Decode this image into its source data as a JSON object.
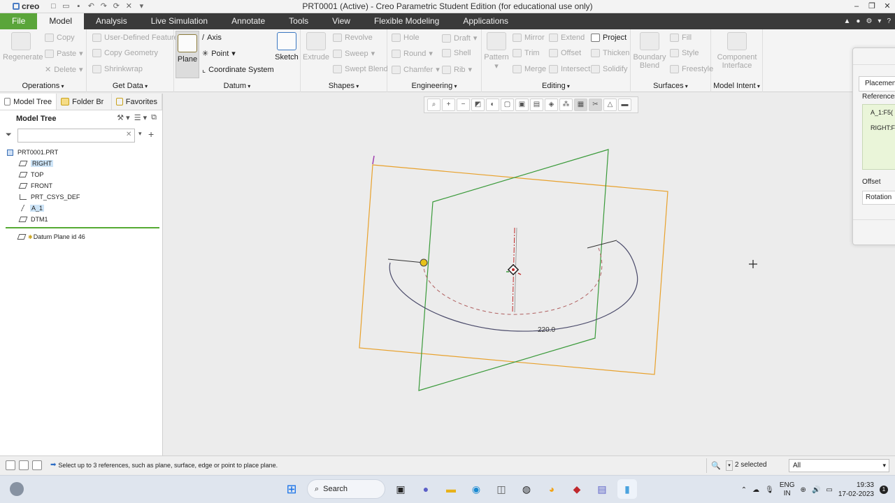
{
  "titlebar": {
    "logo": "creo",
    "title": "PRT0001 (Active) - Creo Parametric Student Edition (for educational use only)"
  },
  "tabs": [
    "File",
    "Model",
    "Analysis",
    "Live Simulation",
    "Annotate",
    "Tools",
    "View",
    "Flexible Modeling",
    "Applications"
  ],
  "active_tab": "Model",
  "ribbon": {
    "operations": {
      "label": "Operations",
      "regenerate": "Regenerate",
      "copy": "Copy",
      "paste": "Paste",
      "delete": "Delete"
    },
    "get_data": {
      "label": "Get Data",
      "udf": "User-Defined Feature",
      "copy_geometry": "Copy Geometry",
      "shrinkwrap": "Shrinkwrap"
    },
    "datum": {
      "label": "Datum",
      "plane": "Plane",
      "axis": "Axis",
      "point": "Point",
      "csys": "Coordinate System",
      "sketch": "Sketch"
    },
    "shapes": {
      "label": "Shapes",
      "extrude": "Extrude",
      "revolve": "Revolve",
      "sweep": "Sweep",
      "swept_blend": "Swept Blend"
    },
    "engineering": {
      "label": "Engineering",
      "hole": "Hole",
      "draft": "Draft",
      "round": "Round",
      "shell": "Shell",
      "chamfer": "Chamfer",
      "rib": "Rib"
    },
    "editing": {
      "label": "Editing",
      "pattern": "Pattern",
      "mirror": "Mirror",
      "extend": "Extend",
      "project": "Project",
      "trim": "Trim",
      "offset": "Offset",
      "thicken": "Thicken",
      "merge": "Merge",
      "intersect": "Intersect",
      "solidify": "Solidify"
    },
    "surfaces": {
      "label": "Surfaces",
      "boundary_blend": "Boundary Blend",
      "fill": "Fill",
      "style": "Style",
      "freestyle": "Freestyle"
    },
    "model_intent": {
      "label": "Model Intent",
      "component_interface": "Component Interface"
    }
  },
  "left_panel": {
    "tabs": [
      "Model Tree",
      "Folder Br",
      "Favorites"
    ],
    "header": "Model Tree",
    "search_value": "",
    "tree": [
      {
        "label": "PRT0001.PRT",
        "icon": "part-icon",
        "highlight": false
      },
      {
        "label": "RIGHT",
        "icon": "datum-plane-icon",
        "highlight": true
      },
      {
        "label": "TOP",
        "icon": "datum-plane-icon",
        "highlight": false
      },
      {
        "label": "FRONT",
        "icon": "datum-plane-icon",
        "highlight": false
      },
      {
        "label": "PRT_CSYS_DEF",
        "icon": "csys-icon",
        "highlight": false
      },
      {
        "label": "A_1",
        "icon": "datum-axis-icon",
        "highlight": true
      },
      {
        "label": "DTM1",
        "icon": "datum-plane-icon",
        "highlight": false
      }
    ],
    "inserting": "Datum Plane id 46"
  },
  "graphics": {
    "dimension": "220.0",
    "colors": {
      "plane_orange": "#e8a12c",
      "plane_green": "#3a9a3a",
      "curve": "#4a4a6a",
      "axis": "#c02a2a",
      "handle": "#e8c21a"
    }
  },
  "dialog": {
    "tab": "Placemen",
    "references_label": "References",
    "references": [
      "A_1:F5(",
      "RIGHT:F"
    ],
    "offset_label": "Offset",
    "rotation_label": "Rotation"
  },
  "status": {
    "message": "Select up to 3 references, such as plane, surface, edge or point to place plane.",
    "selected": "2 selected",
    "filter": "All"
  },
  "taskbar": {
    "search": "Search",
    "lang_top": "ENG",
    "lang_bottom": "IN",
    "time": "19:33",
    "date": "17-02-2023",
    "badge": "1"
  }
}
